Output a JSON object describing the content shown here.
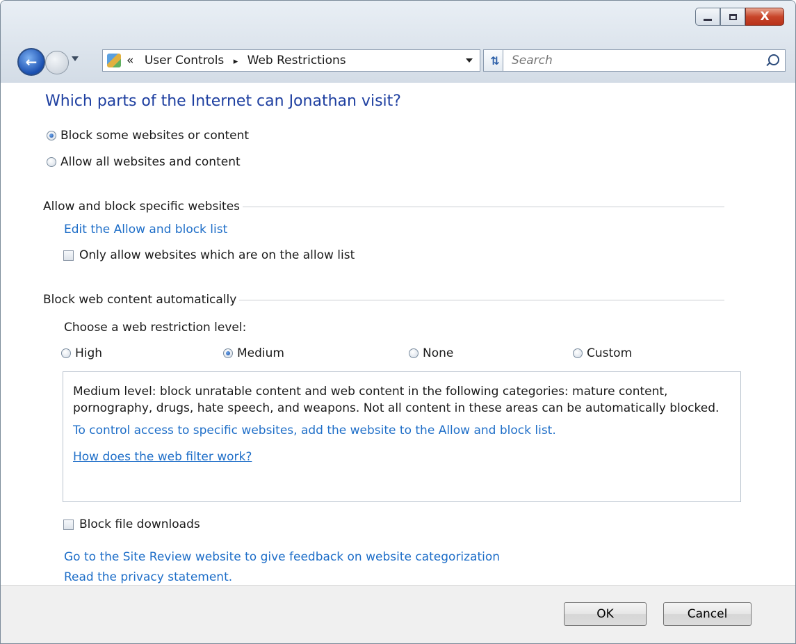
{
  "window": {
    "minimize_icon": "minimize-icon",
    "maximize_icon": "maximize-icon",
    "close_label": "X"
  },
  "nav": {
    "back_icon": "back-arrow-icon",
    "forward_icon": "forward-arrow-icon",
    "breadcrumb_prefix": "«",
    "breadcrumb_1": "User Controls",
    "breadcrumb_sep": "▸",
    "breadcrumb_2": "Web Restrictions",
    "refresh_icon": "refresh-icon",
    "search_placeholder": "Search",
    "search_icon": "search-icon"
  },
  "main": {
    "title": "Which parts of the Internet can Jonathan visit?",
    "radio_block": "Block some websites or content",
    "radio_allow": "Allow all websites and content",
    "section_allow_block": "Allow and block specific websites",
    "edit_list_link": "Edit the Allow and block list",
    "only_allow_checkbox": "Only allow websites which are on the allow list",
    "section_auto": "Block web content automatically",
    "choose_level": "Choose a web restriction level:",
    "levels": [
      "High",
      "Medium",
      "None",
      "Custom"
    ],
    "selected_level": "Medium",
    "description": "Medium level:  block unratable content and web content in the following categories:  mature content, pornography, drugs, hate speech, and weapons.  Not all content in these areas can be automatically blocked.",
    "control_access_link": "To control access to specific websites, add the website to the Allow and block list.",
    "how_filter_link": "How does the web filter work?",
    "block_downloads": "Block file downloads",
    "site_review_link": "Go to the Site Review website to give feedback on website categorization",
    "privacy_link": "Read the privacy statement."
  },
  "footer": {
    "ok": "OK",
    "cancel": "Cancel"
  }
}
